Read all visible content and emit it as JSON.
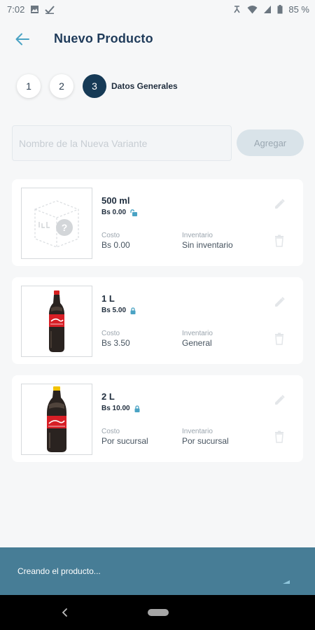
{
  "status_bar": {
    "time": "7:02",
    "battery": "85 %"
  },
  "header": {
    "title": "Nuevo Producto"
  },
  "stepper": {
    "steps": [
      "1",
      "2",
      "3"
    ],
    "active_label": "Datos Generales"
  },
  "variant_form": {
    "placeholder": "Nombre de la Nueva Variante",
    "add_label": "Agregar"
  },
  "variants": [
    {
      "name": "500 ml",
      "price": "Bs 0.00",
      "cost_label": "Costo",
      "cost": "Bs 0.00",
      "inventory_label": "Inventario",
      "inventory": "Sin inventario",
      "lock_icon": "unlocked-icon",
      "image": "placeholder-box-icon"
    },
    {
      "name": "1 L",
      "price": "Bs 5.00",
      "cost_label": "Costo",
      "cost": "Bs 3.50",
      "inventory_label": "Inventario",
      "inventory": "General",
      "lock_icon": "lock-icon",
      "image": "cola-bottle-1l"
    },
    {
      "name": "2 L",
      "price": "Bs 10.00",
      "cost_label": "Costo",
      "cost": "Por sucursal",
      "inventory_label": "Inventario",
      "inventory": "Por sucursal",
      "lock_icon": "lock-icon",
      "image": "cola-bottle-2l"
    }
  ],
  "snackbar": {
    "text": "Creando el producto..."
  },
  "colors": {
    "primary_dark": "#163a56",
    "accent": "#4aa3c4",
    "snackbar": "#477d96",
    "add_button": "#d9e3e9"
  }
}
